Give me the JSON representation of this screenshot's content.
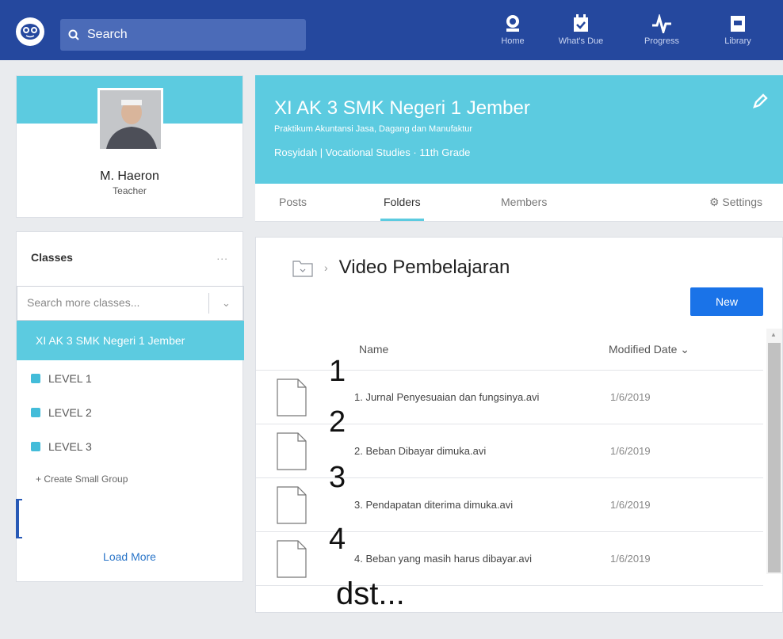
{
  "topbar": {
    "search_placeholder": "Search",
    "nav": [
      {
        "label": "Home",
        "icon": "home-icon"
      },
      {
        "label": "What's Due",
        "icon": "calendar-icon"
      },
      {
        "label": "Progress",
        "icon": "progress-icon"
      },
      {
        "label": "Library",
        "icon": "library-icon"
      }
    ]
  },
  "profile": {
    "name": "M. Haeron",
    "role": "Teacher"
  },
  "classes": {
    "title": "Classes",
    "more": "...",
    "search_placeholder": "Search more classes...",
    "active_class": "XI AK 3 SMK Negeri 1 Jember",
    "levels": [
      "LEVEL 1",
      "LEVEL 2",
      "LEVEL 3"
    ],
    "create_label": "+ Create Small Group",
    "load_more": "Load More"
  },
  "class_header": {
    "name": "XI AK 3 SMK Negeri 1 Jember",
    "subtitle": "Praktikum Akuntansi Jasa, Dagang dan Manufaktur",
    "meta": "Rosyidah  | Vocational Studies · 11th Grade"
  },
  "tabs": {
    "posts": "Posts",
    "folders": "Folders",
    "members": "Members",
    "settings": "Settings"
  },
  "folder": {
    "title": "Video Pembelajaran",
    "new_button": "New",
    "col_name": "Name",
    "col_date": "Modified Date ⌄",
    "files": [
      {
        "name": "1. Jurnal Penyesuaian dan fungsinya.avi",
        "date": "1/6/2019"
      },
      {
        "name": "2. Beban Dibayar dimuka.avi",
        "date": "1/6/2019"
      },
      {
        "name": "3. Pendapatan diterima dimuka.avi",
        "date": "1/6/2019"
      },
      {
        "name": "4. Beban yang masih harus dibayar.avi",
        "date": "1/6/2019"
      }
    ]
  },
  "annotations": {
    "n1": "1",
    "n2": "2",
    "n3": "3",
    "n4": "4",
    "etc": "dst..."
  }
}
